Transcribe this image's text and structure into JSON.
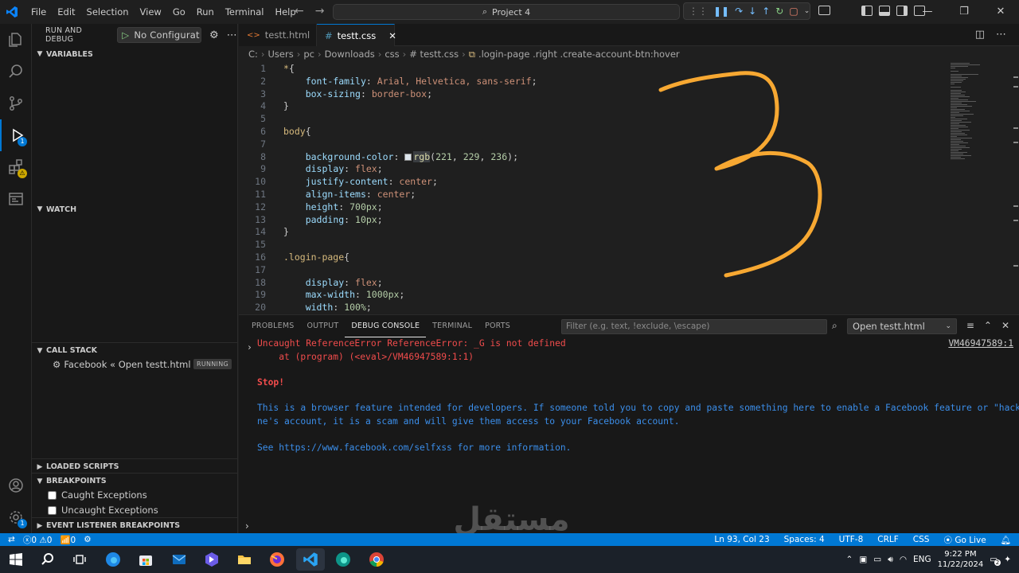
{
  "menu": [
    "File",
    "Edit",
    "Selection",
    "View",
    "Go",
    "Run",
    "Terminal",
    "Help"
  ],
  "search": {
    "label": "Project 4"
  },
  "sidebar": {
    "title": "RUN AND DEBUG",
    "launch_config": "No Configurat",
    "sections": {
      "variables": "VARIABLES",
      "watch": "WATCH",
      "call_stack": "CALL STACK",
      "loaded_scripts": "LOADED SCRIPTS",
      "breakpoints": "BREAKPOINTS",
      "event_listener": "EVENT LISTENER BREAKPOINTS"
    },
    "call_stack_item": "Facebook « Open testt.html",
    "call_stack_status": "RUNNING",
    "breakpoints": [
      {
        "label": "Caught Exceptions",
        "checked": false
      },
      {
        "label": "Uncaught Exceptions",
        "checked": false
      }
    ],
    "run_badge": "1"
  },
  "tabs": [
    {
      "label": "testt.html",
      "icon": "html-icon",
      "active": false
    },
    {
      "label": "testt.css",
      "icon": "css-hash-icon",
      "active": true
    }
  ],
  "breadcrumbs": [
    "C:",
    "Users",
    "pc",
    "Downloads",
    "css",
    "# testt.css",
    ".login-page .right .create-account-btn:hover"
  ],
  "code_lines": [
    {
      "n": "1",
      "text": "*{"
    },
    {
      "n": "2",
      "text": "    font-family: Arial, Helvetica, sans-serif;"
    },
    {
      "n": "3",
      "text": "    box-sizing: border-box;"
    },
    {
      "n": "4",
      "text": "}"
    },
    {
      "n": "5",
      "text": ""
    },
    {
      "n": "6",
      "text": "body{"
    },
    {
      "n": "7",
      "text": ""
    },
    {
      "n": "8",
      "text": "    background-color: rgb(221, 229, 236);"
    },
    {
      "n": "9",
      "text": "    display: flex;"
    },
    {
      "n": "10",
      "text": "    justify-content: center;"
    },
    {
      "n": "11",
      "text": "    align-items: center;"
    },
    {
      "n": "12",
      "text": "    height: 700px;"
    },
    {
      "n": "13",
      "text": "    padding: 10px;"
    },
    {
      "n": "14",
      "text": "}"
    },
    {
      "n": "15",
      "text": ""
    },
    {
      "n": "16",
      "text": ".login-page{"
    },
    {
      "n": "17",
      "text": ""
    },
    {
      "n": "18",
      "text": "    display: flex;"
    },
    {
      "n": "19",
      "text": "    max-width: 1000px;"
    },
    {
      "n": "20",
      "text": "    width: 100%;"
    }
  ],
  "panel": {
    "tabs": [
      "PROBLEMS",
      "OUTPUT",
      "DEBUG CONSOLE",
      "TERMINAL",
      "PORTS"
    ],
    "active_tab": "DEBUG CONSOLE",
    "filter_placeholder": "Filter (e.g. text, !exclude, \\escape)",
    "session": "Open testt.html",
    "console": {
      "error_line1": "Uncaught ReferenceError ReferenceError: _G is not defined",
      "error_line2": "    at (program) (<eval>/VM46947589:1:1)",
      "vm_link": "VM46947589:1",
      "stop": "Stop!",
      "warn_line1": "This is a browser feature intended for developers. If someone told you to copy and paste something here to enable a Facebook feature or \"hack\" someo",
      "warn_line2": "ne's account, it is a scam and will give them access to your Facebook account.",
      "see_line": "See https://www.facebook.com/selfxss for more information."
    }
  },
  "statusbar": {
    "errors": "0",
    "warnings": "0",
    "ports": "0",
    "position": "Ln 93, Col 23",
    "spaces": "Spaces: 4",
    "encoding": "UTF-8",
    "eol": "CRLF",
    "language": "CSS",
    "golive": "Go Live"
  },
  "watermark": {
    "arabic": "مستقل",
    "latin": "mostaql.com"
  },
  "taskbar": {
    "lang": "ENG",
    "time": "9:22 PM",
    "date": "11/22/2024"
  },
  "colors": {
    "accent": "#0078d4",
    "annotation": "#f7a832",
    "error": "#f14c4c",
    "info": "#3b8eea"
  }
}
